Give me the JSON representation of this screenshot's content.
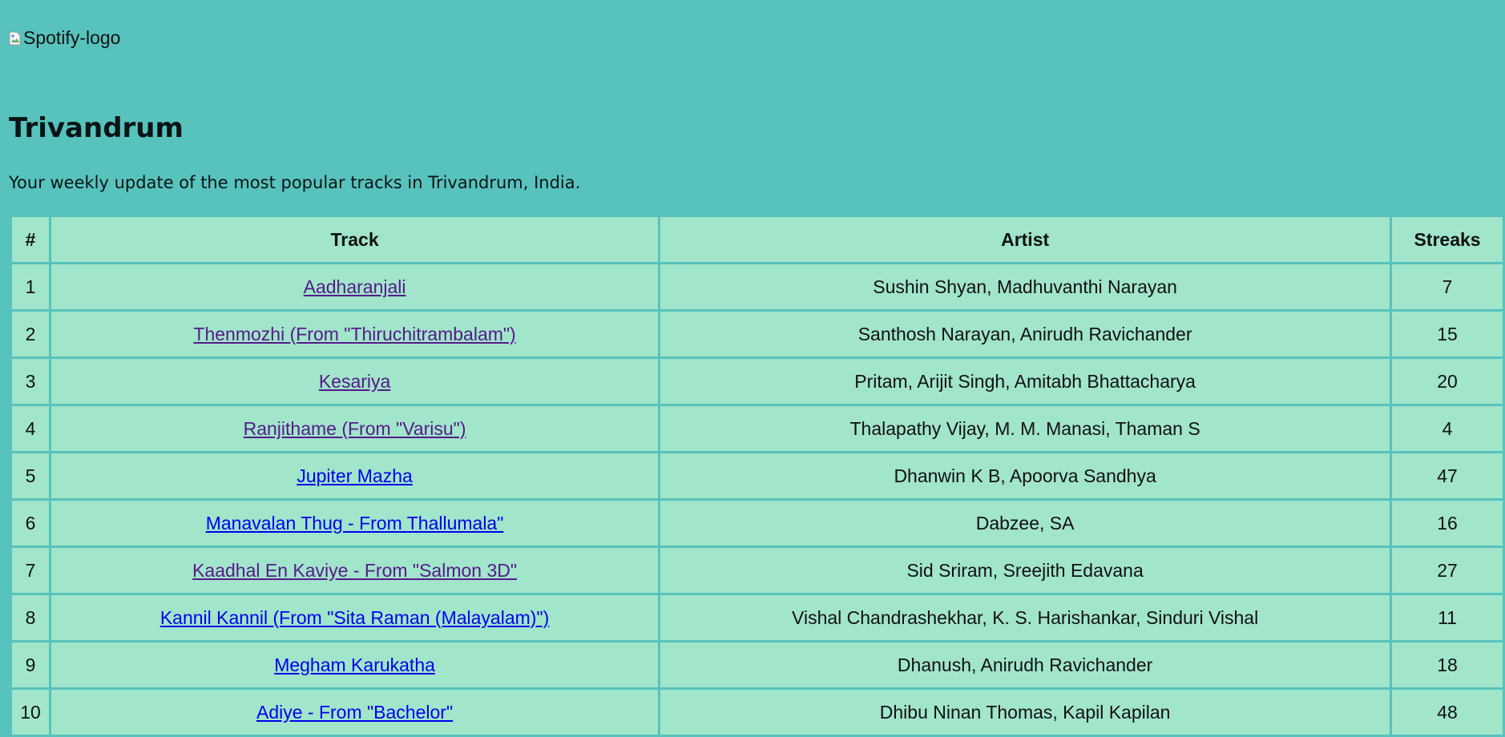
{
  "header": {
    "logo_alt": "Spotify-logo",
    "title": "Trivandrum",
    "subtitle": "Your weekly update of the most popular tracks in Trivandrum, India."
  },
  "table": {
    "columns": [
      "#",
      "Track",
      "Artist",
      "Streaks"
    ],
    "rows": [
      {
        "rank": "1",
        "track": "Aadharanjali",
        "artist": "Sushin Shyan, Madhuvanthi Narayan",
        "streaks": "7",
        "visited": true
      },
      {
        "rank": "2",
        "track": "Thenmozhi (From \"Thiruchitrambalam\")",
        "artist": "Santhosh Narayan, Anirudh Ravichander",
        "streaks": "15",
        "visited": true
      },
      {
        "rank": "3",
        "track": "Kesariya",
        "artist": "Pritam, Arijit Singh, Amitabh Bhattacharya",
        "streaks": "20",
        "visited": true
      },
      {
        "rank": "4",
        "track": "Ranjithame (From \"Varisu\")",
        "artist": "Thalapathy Vijay, M. M. Manasi, Thaman S",
        "streaks": "4",
        "visited": true
      },
      {
        "rank": "5",
        "track": "Jupiter Mazha",
        "artist": "Dhanwin K B, Apoorva Sandhya",
        "streaks": "47",
        "visited": false
      },
      {
        "rank": "6",
        "track": "Manavalan Thug - From Thallumala\"",
        "artist": "Dabzee, SA",
        "streaks": "16",
        "visited": false
      },
      {
        "rank": "7",
        "track": "Kaadhal En Kaviye - From \"Salmon 3D\"",
        "artist": "Sid Sriram, Sreejith Edavana",
        "streaks": "27",
        "visited": true
      },
      {
        "rank": "8",
        "track": "Kannil Kannil (From \"Sita Raman (Malayalam)\")",
        "artist": "Vishal Chandrashekhar, K. S. Harishankar, Sinduri Vishal",
        "streaks": "11",
        "visited": false
      },
      {
        "rank": "9",
        "track": "Megham Karukatha",
        "artist": "Dhanush, Anirudh Ravichander",
        "streaks": "18",
        "visited": false
      },
      {
        "rank": "10",
        "track": "Adiye - From \"Bachelor\"",
        "artist": "Dhibu Ninan Thomas, Kapil Kapilan",
        "streaks": "48",
        "visited": false
      }
    ]
  },
  "colors": {
    "page_bg": "#58c2bd",
    "cell_bg": "#a1e5ca",
    "link_visited": "#551a8b",
    "link_unvisited": "#0000ee"
  }
}
